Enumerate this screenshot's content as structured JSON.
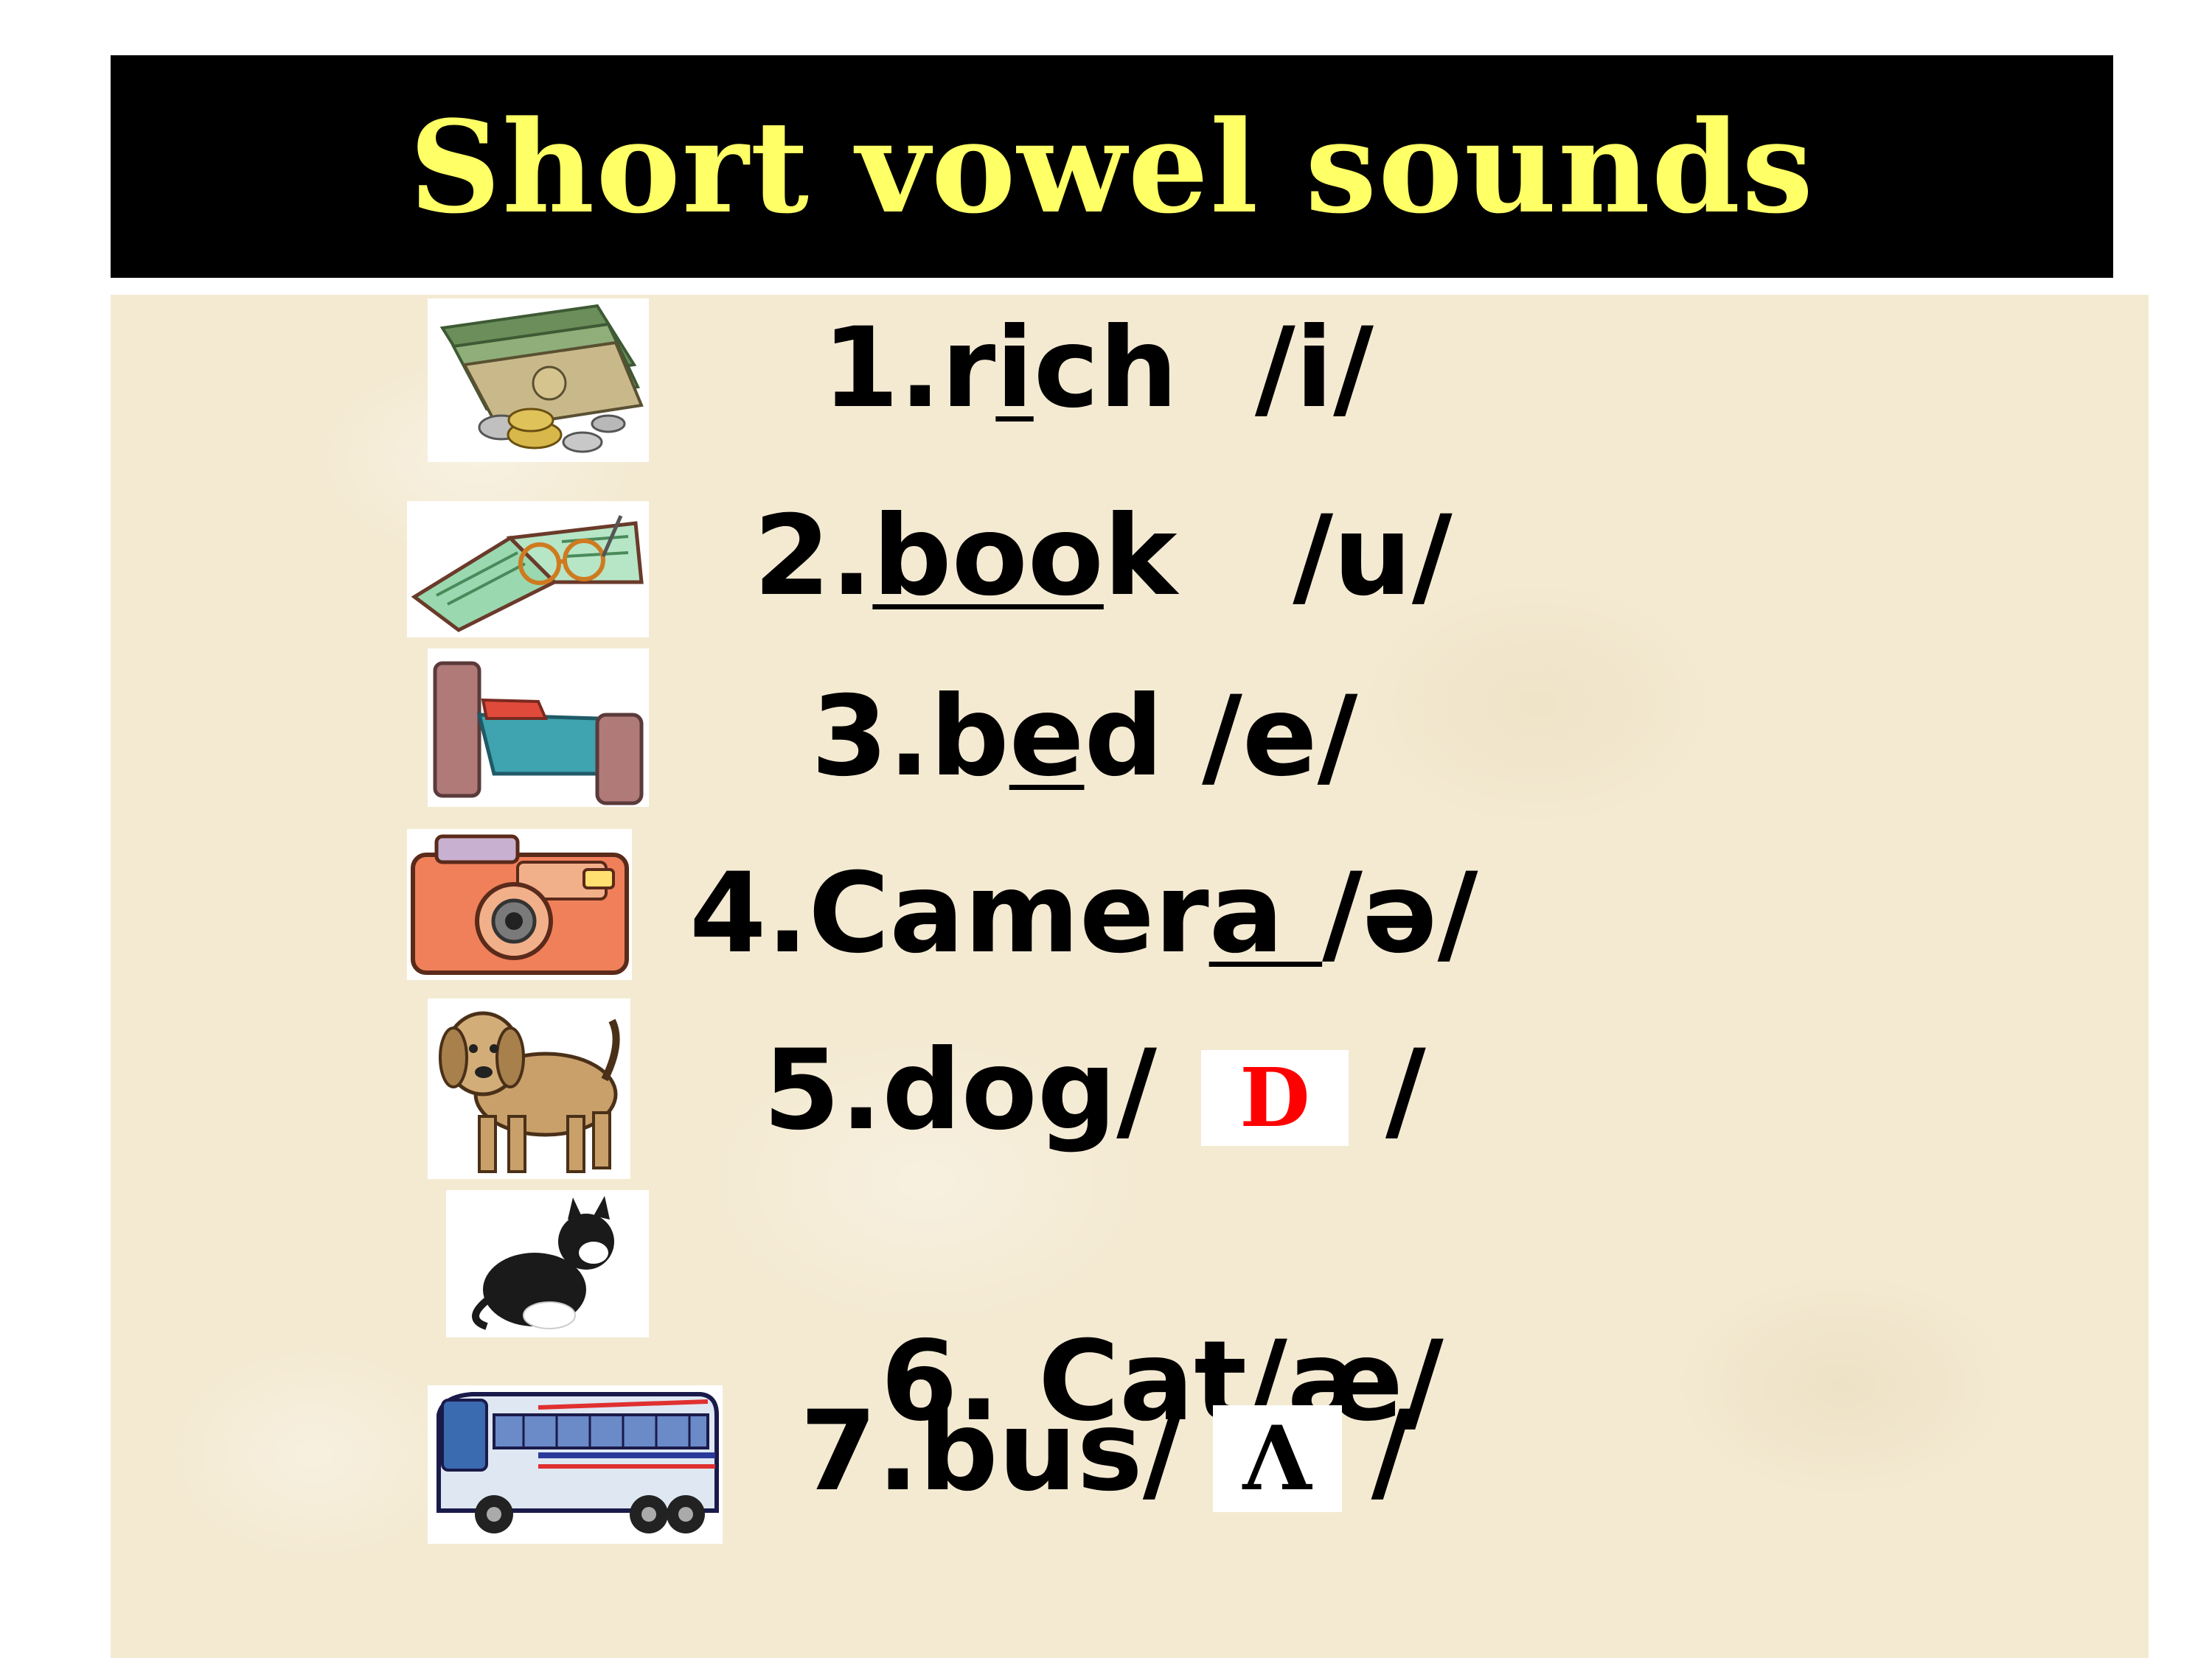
{
  "title": "Short vowel sounds",
  "colors": {
    "title_bg": "#000000",
    "title_text": "#ffff66",
    "background": "#f4ead2",
    "symbol_d": "#ff0000"
  },
  "items": [
    {
      "number": "1.",
      "pre": "r",
      "vowel": "i",
      "post": "ch",
      "ipa": "/i/",
      "icon": "money-icon"
    },
    {
      "number": "2.",
      "pre": "",
      "vowel": "boo",
      "post": "k",
      "ipa": "/u/",
      "icon": "book-with-glasses-icon"
    },
    {
      "number": "3.",
      "pre": "b",
      "vowel": "e",
      "post": "d",
      "ipa": "/e/",
      "icon": "bed-icon"
    },
    {
      "number": "4.",
      "pre": "Camer",
      "vowel": "a ",
      "post": "",
      "ipa": "/ə/",
      "icon": "camera-icon"
    },
    {
      "number": "5.",
      "word": "dog/",
      "symbol": "D",
      "close": "/",
      "icon": "dog-icon"
    },
    {
      "number": "6.",
      "word": " Cat/æ/",
      "icon": "cat-icon"
    },
    {
      "number": "7.",
      "word": "bus/",
      "symbol": "Λ",
      "close": "/",
      "icon": "bus-icon"
    }
  ]
}
